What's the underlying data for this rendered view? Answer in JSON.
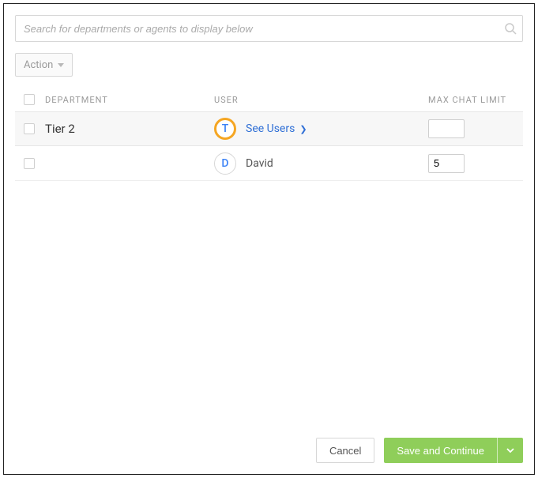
{
  "search": {
    "placeholder": "Search for departments or agents to display below",
    "value": ""
  },
  "action_button": {
    "label": "Action"
  },
  "columns": {
    "department": "DEPARTMENT",
    "user": "USER",
    "max_chat_limit": "MAX CHAT LIMIT"
  },
  "rows": [
    {
      "checked": false,
      "department": "Tier 2",
      "avatar_letter": "T",
      "avatar_style": "t",
      "user_link_label": "See Users",
      "user_is_link": true,
      "max_chat_limit": "",
      "highlight": true
    },
    {
      "checked": false,
      "department": "",
      "avatar_letter": "D",
      "avatar_style": "d",
      "user_name": "David",
      "user_is_link": false,
      "max_chat_limit": "5",
      "highlight": false
    }
  ],
  "footer": {
    "cancel": "Cancel",
    "save": "Save and Continue"
  }
}
